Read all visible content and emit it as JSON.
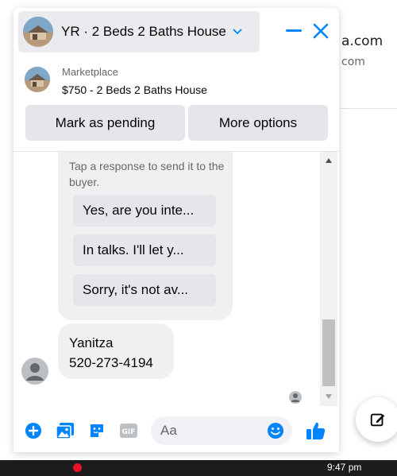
{
  "background": {
    "text_line1": "a.com",
    "text_line2": "com"
  },
  "chat": {
    "title": "YR · 2 Beds 2 Baths House",
    "listing": {
      "category": "Marketplace",
      "title": "$750 - 2 Beds 2 Baths House"
    },
    "actions": {
      "mark_pending": "Mark as pending",
      "more_options": "More options"
    },
    "responses": {
      "hint": "Tap a response to send it to the buyer.",
      "items": [
        "Yes, are you inte...",
        "In talks. I'll let y...",
        "Sorry, it's not av..."
      ]
    },
    "contact_message": {
      "line1": "Yanitza",
      "line2": "520-273-4194"
    },
    "composer": {
      "placeholder": "Aa"
    }
  },
  "taskbar": {
    "time": "9:47 pm"
  },
  "colors": {
    "accent": "#0084ff",
    "bubble": "#f0f0f0",
    "button": "#e4e6eb"
  }
}
